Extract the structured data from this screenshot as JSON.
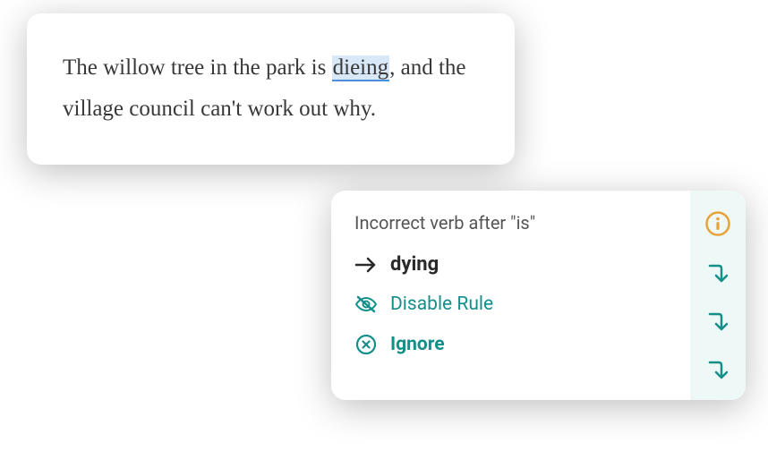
{
  "textCard": {
    "before": "The willow tree in the park is ",
    "error": "dieing",
    "after": ", and the village council can't work out why."
  },
  "suggestion": {
    "title": "Incorrect verb after \"is\"",
    "correction": "dying",
    "disableLabel": "Disable Rule",
    "ignoreLabel": "Ignore"
  }
}
